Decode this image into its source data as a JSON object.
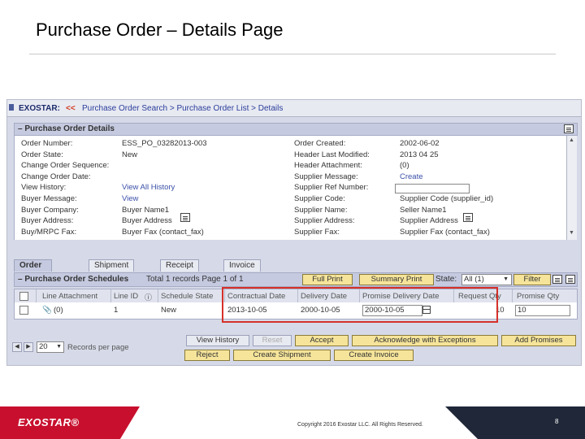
{
  "slide": {
    "title": "Purchase Order – Details Page",
    "copyright": "Copyright 2016 Exostar LLC. All Rights Reserved.",
    "page_number": "8",
    "brand": "EXOSTAR®",
    "brand_color": "#c8102e"
  },
  "breadcrumb": {
    "logo": "EXOSTAR:",
    "back": "<<",
    "path": "Purchase Order Search > Purchase Order List > Details"
  },
  "details": {
    "header": "– Purchase Order Details",
    "left": [
      {
        "label": "Order Number:",
        "value": "ESS_PO_03282013-003"
      },
      {
        "label": "Order State:",
        "value": "New"
      },
      {
        "label": "Change Order Sequence:",
        "value": ""
      },
      {
        "label": "Change Order Date:",
        "value": ""
      },
      {
        "label": "View History:",
        "value": "View All History"
      },
      {
        "label": "Buyer Message:",
        "value": "View"
      },
      {
        "label": "Buyer Company:",
        "value": "Buyer Name1"
      },
      {
        "label": "Buyer Address:",
        "value": "Buyer Address"
      },
      {
        "label": "Buy/MRPC Fax:",
        "value": "Buyer Fax (contact_fax)"
      }
    ],
    "right": [
      {
        "label": "Order Created:",
        "value": "2002-06-02"
      },
      {
        "label": "Header Last Modified:",
        "value": "2013 04 25"
      },
      {
        "label": "Header Attachment:",
        "value": "(0)"
      },
      {
        "label": "Supplier Message:",
        "value": "Create"
      },
      {
        "label": "Supplier Ref Number:",
        "value": ""
      },
      {
        "label": "Supplier Code:",
        "value": "Supplier Code (supplier_id)"
      },
      {
        "label": "Supplier Name:",
        "value": "Seller Name1"
      },
      {
        "label": "Supplier Address:",
        "value": "Supplier Address"
      },
      {
        "label": "Supplier Fax:",
        "value": "Supplier Fax (contact_fax)"
      }
    ]
  },
  "tabs": [
    "Order Details",
    "Shipment Info",
    "Receipt Info",
    "Invoice Info"
  ],
  "schedules": {
    "title": "– Purchase Order Schedules",
    "summary": "Total 1 records Page 1 of 1",
    "full_print": "Full Print",
    "summary_print": "Summary Print",
    "state_label": "State:",
    "state_value": "All (1)",
    "filter": "Filter",
    "columns": [
      "Line Attachment",
      "Line ID",
      "Schedule State",
      "Contractual Date",
      "Delivery Date",
      "Promise Delivery Date",
      "Request Qty",
      "Promise Qty"
    ],
    "row": {
      "attachment": "(0)",
      "line_id": "1",
      "state": "New",
      "contractual_date": "2013-10-05",
      "delivery_date": "2000-10-05",
      "promise_delivery_date": "2000-10-05",
      "request_qty": "10",
      "promise_qty": "10"
    }
  },
  "pager": {
    "per_page_value": "20",
    "per_page_label": "Records per page"
  },
  "actions": {
    "view_history": "View History",
    "reset": "Reset",
    "accept": "Accept",
    "ack_exceptions": "Acknowledge with Exceptions",
    "add_promises": "Add Promises",
    "reject": "Reject",
    "create_shipment": "Create Shipment",
    "create_invoice": "Create Invoice"
  }
}
